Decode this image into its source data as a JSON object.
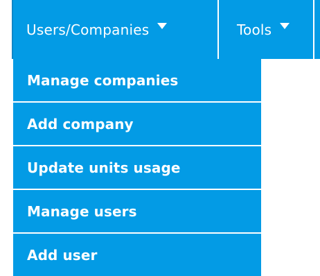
{
  "menubar": {
    "items": [
      {
        "label": "Users/Companies"
      },
      {
        "label": "Tools"
      }
    ]
  },
  "dropdown": {
    "items": [
      {
        "label": "Manage companies"
      },
      {
        "label": "Add company"
      },
      {
        "label": "Update units usage"
      },
      {
        "label": "Manage users"
      },
      {
        "label": "Add user"
      }
    ]
  },
  "colors": {
    "menu_background": "#039be5",
    "text": "#ffffff"
  }
}
